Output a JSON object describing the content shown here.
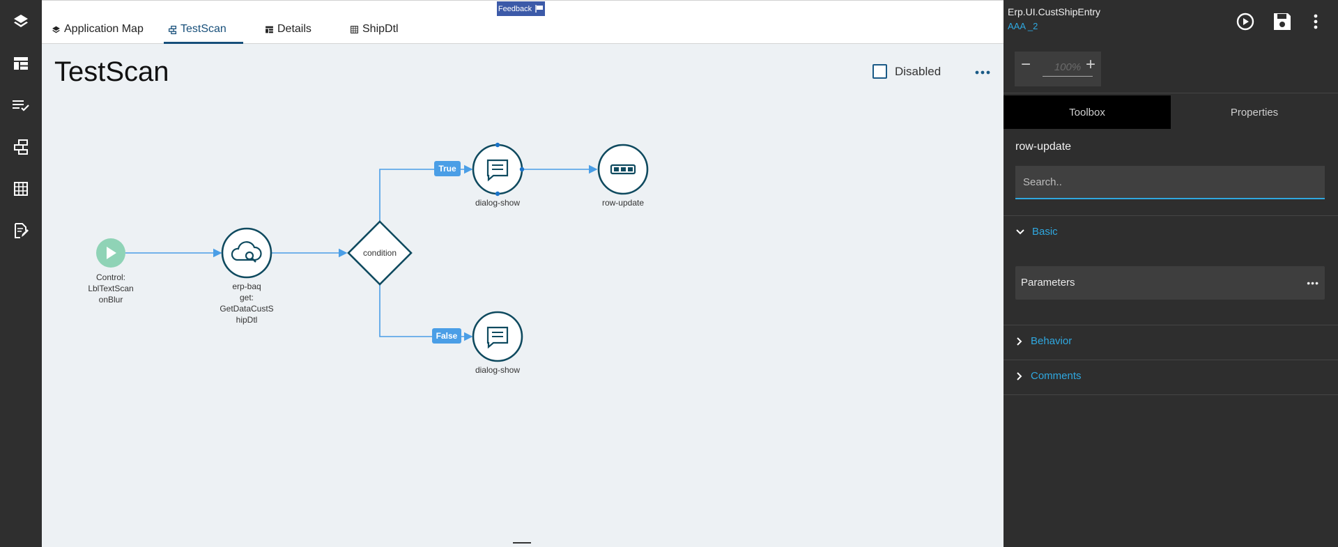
{
  "sidebar": {
    "icons": [
      "layers-icon",
      "layout-icon",
      "checklist-icon",
      "flow-icon",
      "grid-icon",
      "edit-doc-icon"
    ]
  },
  "tabs": [
    {
      "label": "Application Map",
      "icon": "layers-icon"
    },
    {
      "label": "TestScan",
      "icon": "event-icon",
      "active": true
    },
    {
      "label": "Details",
      "icon": "layout-icon"
    },
    {
      "label": "ShipDtl",
      "icon": "grid-icon"
    }
  ],
  "feedback": {
    "label": "Feedback"
  },
  "page": {
    "title": "TestScan",
    "disabled_label": "Disabled",
    "disabled_checked": false
  },
  "flow": {
    "start_label": [
      "Control:",
      "LblTextScan",
      "onBlur"
    ],
    "erp_label": [
      "erp-baq",
      "get:",
      "GetDataCustS",
      "hipDtl"
    ],
    "condition_label": "condition",
    "true_badge": "True",
    "false_badge": "False",
    "dialog_top_label": "dialog-show",
    "row_update_label": "row-update",
    "dialog_bottom_label": "dialog-show"
  },
  "panel": {
    "app_name": "Erp.UI.CustShipEntry",
    "layer_name": "AAA _2",
    "zoom_value": "100%",
    "tabs": {
      "toolbox": "Toolbox",
      "properties": "Properties"
    },
    "selected": "row-update",
    "search_placeholder": "Search..",
    "sections": {
      "basic": "Basic",
      "parameters": "Parameters",
      "behavior": "Behavior",
      "comments": "Comments"
    }
  },
  "colors": {
    "accent": "#174f7a",
    "link": "#2fa8e0",
    "flow_line": "#4a9ee6",
    "node_stroke": "#0f4a5f",
    "start_node": "#8fd3b6"
  }
}
